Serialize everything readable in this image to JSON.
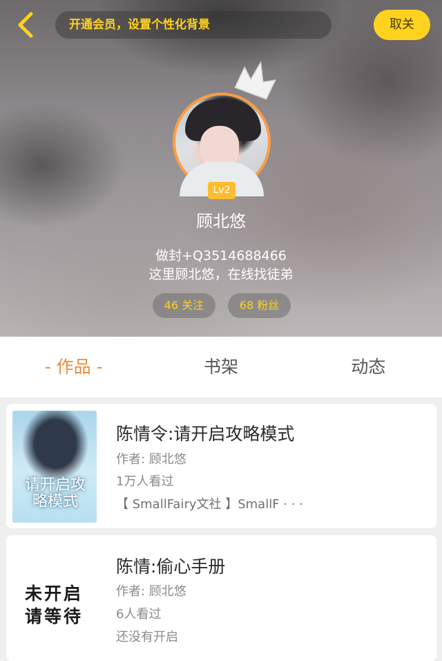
{
  "header": {
    "vip_banner": "开通会员，设置个性化背景",
    "close_label": "取关",
    "level": "Lv2",
    "username": "顾北悠",
    "bio_line1": "做封+Q3514688466",
    "bio_line2": "这里顾北悠，在线找徒弟",
    "follow_stat": "46 关注",
    "fans_stat": "68 粉丝"
  },
  "tabs": [
    {
      "label": "作品",
      "active": true
    },
    {
      "label": "书架",
      "active": false
    },
    {
      "label": "动态",
      "active": false
    }
  ],
  "books": [
    {
      "title": "陈情令:请开启攻略模式",
      "author": "作者: 顾北悠",
      "views": "1万人看过",
      "tags": "【 SmallFairy文社 】SmallF · · ·",
      "cover_text": "请开启攻略模式"
    },
    {
      "title": "陈情:偷心手册",
      "author": "作者: 顾北悠",
      "views": "6人看过",
      "status": "还没有开启",
      "cover_text_line1": "未开启",
      "cover_text_line2": "请等待"
    }
  ],
  "colors": {
    "accent_yellow": "#ffd21f",
    "accent_orange": "#f08a3a",
    "avatar_ring": "#ff9c45",
    "level_badge": "#ffbd2e"
  },
  "icons": {
    "back": "chevron-left-icon",
    "crown": "crown-icon"
  }
}
